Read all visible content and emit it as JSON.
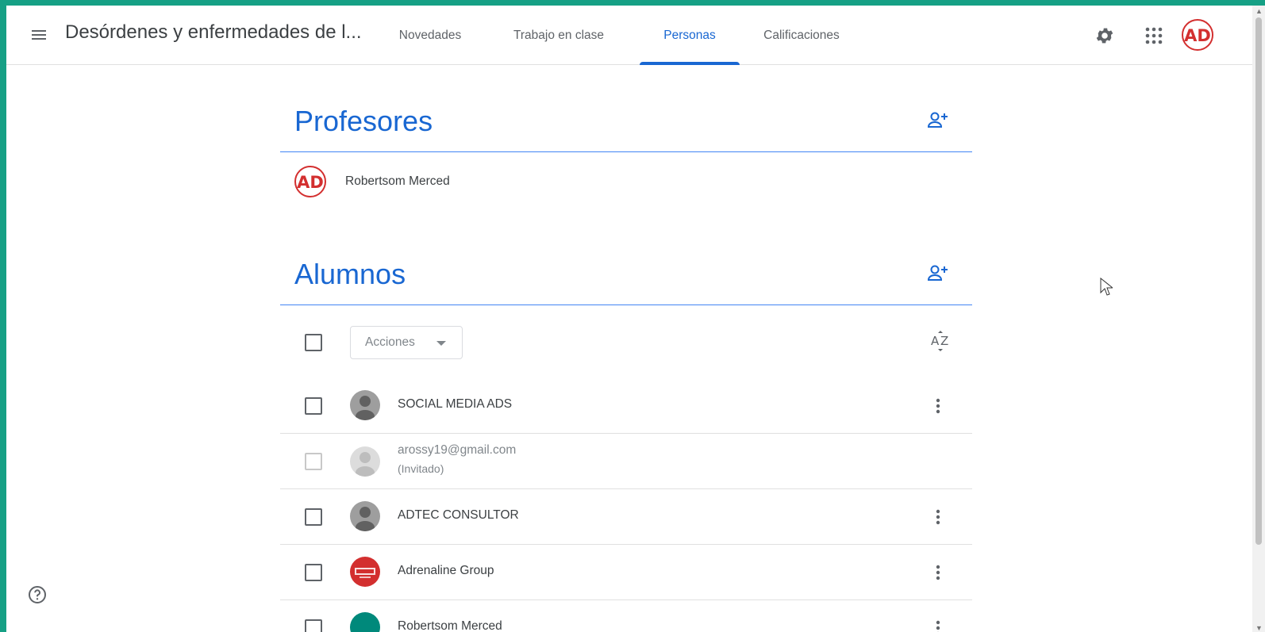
{
  "header": {
    "course_title": "Desórdenes y enfermedades de l...",
    "tabs": [
      {
        "label": "Novedades",
        "active": false
      },
      {
        "label": "Trabajo en clase",
        "active": false
      },
      {
        "label": "Personas",
        "active": true
      },
      {
        "label": "Calificaciones",
        "active": false
      }
    ],
    "account_initials": "AD"
  },
  "teachers": {
    "title": "Profesores",
    "items": [
      {
        "name": "Robertsom Merced",
        "avatar_initials": "AD"
      }
    ]
  },
  "students": {
    "title": "Alumnos",
    "actions_label": "Acciones",
    "items": [
      {
        "name": "SOCIAL MEDIA ADS",
        "avatar": "default-person"
      },
      {
        "name": "arossy19@gmail.com",
        "status": "(Invitado)",
        "avatar": "default-person-faded"
      },
      {
        "name": "ADTEC CONSULTOR",
        "avatar": "default-person"
      },
      {
        "name": "Adrenaline Group",
        "avatar": "red-logo"
      },
      {
        "name": "Robertsom Merced",
        "avatar": "teal-circle"
      }
    ]
  },
  "colors": {
    "accent": "#1967d2",
    "frame": "#16a085",
    "logo_red": "#d32f2f",
    "teal_avatar": "#00897b"
  }
}
